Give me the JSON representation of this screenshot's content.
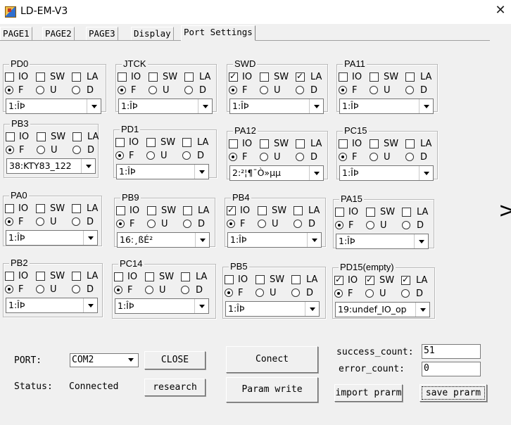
{
  "window": {
    "title": "LD-EM-V3",
    "close_symbol": "✕"
  },
  "tabs": [
    {
      "label": "PAGE1",
      "active": false
    },
    {
      "label": "PAGE2",
      "active": false
    },
    {
      "label": "PAGE3",
      "active": false
    },
    {
      "label": "Display",
      "active": false
    },
    {
      "label": "Port Settings",
      "active": true
    }
  ],
  "overflow_arrow": ">",
  "option_labels": {
    "io": "IO",
    "sw": "SW",
    "la": "LA",
    "f": "F",
    "u": "U",
    "d": "D"
  },
  "pins": [
    {
      "name": "PD0",
      "io": false,
      "sw": false,
      "la": false,
      "mode": "F",
      "value": "1:ÎÞ"
    },
    {
      "name": "JTCK",
      "io": false,
      "sw": false,
      "la": false,
      "mode": "F",
      "value": "1:ÎÞ"
    },
    {
      "name": "SWD",
      "io": true,
      "sw": false,
      "la": true,
      "mode": "F",
      "value": "1:ÎÞ"
    },
    {
      "name": "PA11",
      "io": false,
      "sw": false,
      "la": false,
      "mode": "F",
      "value": "1:ÎÞ"
    },
    {
      "name": "PB3",
      "io": false,
      "sw": false,
      "la": false,
      "mode": "F",
      "value": "38:KTY83_122"
    },
    {
      "name": "PD1",
      "io": false,
      "sw": false,
      "la": false,
      "mode": "F",
      "value": "1:ÎÞ"
    },
    {
      "name": "PA12",
      "io": false,
      "sw": false,
      "la": false,
      "mode": "F",
      "value": "2:²¦¶¯Ò»µµ"
    },
    {
      "name": "PC15",
      "io": false,
      "sw": false,
      "la": false,
      "mode": "F",
      "value": "1:ÎÞ"
    },
    {
      "name": "PA0",
      "io": false,
      "sw": false,
      "la": false,
      "mode": "F",
      "value": "1:ÎÞ"
    },
    {
      "name": "PB9",
      "io": false,
      "sw": false,
      "la": false,
      "mode": "F",
      "value": "16:¸ßÉ²"
    },
    {
      "name": "PB4",
      "io": true,
      "sw": false,
      "la": false,
      "mode": "F",
      "value": "1:ÎÞ"
    },
    {
      "name": "PA15",
      "io": false,
      "sw": false,
      "la": false,
      "mode": "F",
      "value": "1:ÎÞ"
    },
    {
      "name": "PB2",
      "io": false,
      "sw": false,
      "la": false,
      "mode": "F",
      "value": "1:ÎÞ"
    },
    {
      "name": "PC14",
      "io": false,
      "sw": false,
      "la": false,
      "mode": "F",
      "value": "1:ÎÞ"
    },
    {
      "name": "PB5",
      "io": false,
      "sw": false,
      "la": false,
      "mode": "F",
      "value": "1:ÎÞ"
    },
    {
      "name": "PD15(empty)",
      "io": true,
      "sw": true,
      "la": true,
      "mode": "F",
      "value": "19:undef_IO_op"
    }
  ],
  "bottom": {
    "port_label": "PORT:",
    "port_value": "COM2",
    "close_button": "CLOSE",
    "status_label": "Status:",
    "status_value": "Connected",
    "research_button": "research",
    "connect_button": "Conect",
    "param_write_button": "Param write",
    "success_label": "success_count:",
    "success_value": "51",
    "error_label": "error_count:",
    "error_value": "0",
    "import_button": "import prarm",
    "save_button": "save prarm"
  }
}
